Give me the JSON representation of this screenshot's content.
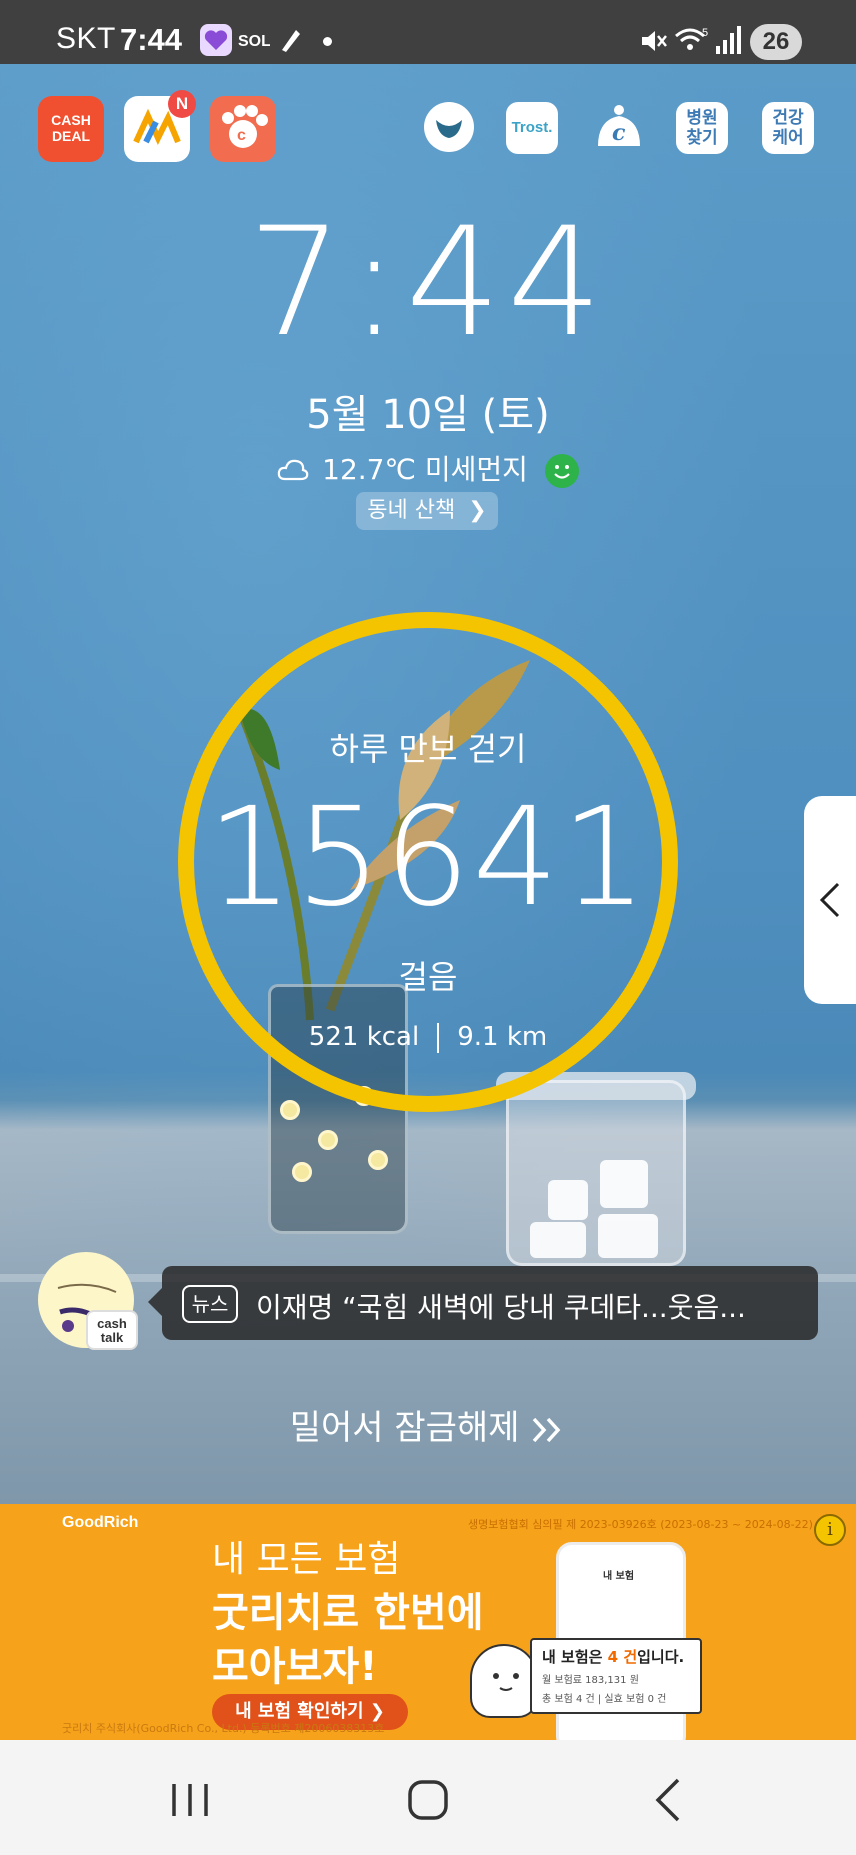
{
  "status_bar": {
    "carrier": "SKT",
    "time": "7:44",
    "battery": "26",
    "icons": [
      "heart-app-icon",
      "sol-bank-icon",
      "pen-app-icon",
      "notification-dot",
      "mute-icon",
      "wifi-5g-icon",
      "signal-icon"
    ]
  },
  "shortcuts": {
    "cash_deal": "CASH\nDEAL",
    "cash_deal_line1": "CASH",
    "cash_deal_line2": "DEAL",
    "news_badge": "N",
    "trost": "Trost.",
    "hospital_line1": "병원",
    "hospital_line2": "찾기",
    "health_line1": "건강",
    "health_line2": "케어"
  },
  "lockscreen": {
    "time": "7:44",
    "date": "5월 10일 (토)",
    "weather": "12.7℃ 미세먼지",
    "walk_chip": "동네 산책"
  },
  "steps": {
    "title": "하루 만보 걷기",
    "count": "15641",
    "unit": "걸음",
    "kcal": "521 kcal",
    "distance": "9.1 km",
    "ring_color": "#f5c400"
  },
  "news": {
    "tag": "뉴스",
    "headline": "이재명 “국힘 새벽에 당내 쿠데타...웃음...",
    "badge_line1": "cash",
    "badge_line2": "talk"
  },
  "unlock_text": "밀어서 잠금해제",
  "ad": {
    "brand": "GoodRich",
    "registration": "생명보험협회 심의필 제 2023-03926호 (2023-08-23 ~ 2024-08-22)",
    "line1": "내 모든 보험",
    "line2": "굿리치로 한번에",
    "line3": "모아보자!",
    "cta": "내 보험 확인하기 ❯",
    "company": "굿리치 주식회사(GoodRich Co., Ltd.) 등록번호 제2006038313호",
    "phone_title": "내 보험",
    "card_title_pre": "내 보험은 ",
    "card_title_highlight": "4 건",
    "card_title_post": "입니다.",
    "card_line1": "월 보험료 183,131 원",
    "card_line2": "총 보험 4 건 | 실효 보험 0 건",
    "background": "#f7a21b"
  },
  "navbar": {
    "buttons": [
      "recent-apps-button",
      "home-button",
      "back-button"
    ]
  }
}
